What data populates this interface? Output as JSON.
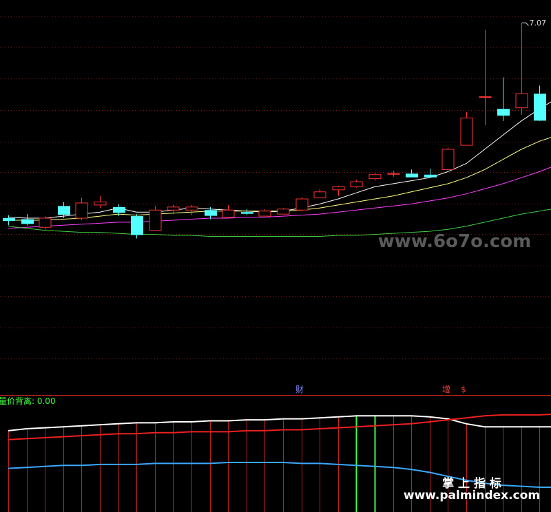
{
  "chart_data": [
    {
      "type": "candlestick",
      "panel": "price",
      "peak_label": "7.07",
      "colors": {
        "up": "#ff3232",
        "down": "#54ffff",
        "grid": "#8a1a1a",
        "bg": "#000000"
      },
      "ylim": [
        4.1,
        7.2
      ],
      "candles": [
        {
          "o": 5.14,
          "h": 5.17,
          "l": 5.07,
          "c": 5.12
        },
        {
          "o": 5.13,
          "h": 5.18,
          "l": 5.07,
          "c": 5.09
        },
        {
          "o": 5.05,
          "h": 5.16,
          "l": 5.02,
          "c": 5.14
        },
        {
          "o": 5.26,
          "h": 5.3,
          "l": 5.14,
          "c": 5.18
        },
        {
          "o": 5.14,
          "h": 5.34,
          "l": 5.12,
          "c": 5.29
        },
        {
          "o": 5.27,
          "h": 5.36,
          "l": 5.24,
          "c": 5.3
        },
        {
          "o": 5.25,
          "h": 5.28,
          "l": 5.16,
          "c": 5.2
        },
        {
          "o": 5.16,
          "h": 5.18,
          "l": 4.94,
          "c": 4.98
        },
        {
          "o": 5.02,
          "h": 5.26,
          "l": 5.02,
          "c": 5.22
        },
        {
          "o": 5.22,
          "h": 5.27,
          "l": 5.18,
          "c": 5.25
        },
        {
          "o": 5.22,
          "h": 5.27,
          "l": 5.17,
          "c": 5.25
        },
        {
          "o": 5.22,
          "h": 5.25,
          "l": 5.13,
          "c": 5.17
        },
        {
          "o": 5.15,
          "h": 5.27,
          "l": 5.15,
          "c": 5.22
        },
        {
          "o": 5.2,
          "h": 5.23,
          "l": 5.17,
          "c": 5.19
        },
        {
          "o": 5.16,
          "h": 5.23,
          "l": 5.16,
          "c": 5.21
        },
        {
          "o": 5.18,
          "h": 5.24,
          "l": 5.18,
          "c": 5.23
        },
        {
          "o": 5.22,
          "h": 5.35,
          "l": 5.21,
          "c": 5.33
        },
        {
          "o": 5.34,
          "h": 5.43,
          "l": 5.34,
          "c": 5.4
        },
        {
          "o": 5.42,
          "h": 5.46,
          "l": 5.36,
          "c": 5.45
        },
        {
          "o": 5.45,
          "h": 5.52,
          "l": 5.44,
          "c": 5.5
        },
        {
          "o": 5.53,
          "h": 5.59,
          "l": 5.51,
          "c": 5.57
        },
        {
          "o": 5.58,
          "h": 5.61,
          "l": 5.55,
          "c": 5.58
        },
        {
          "o": 5.58,
          "h": 5.62,
          "l": 5.56,
          "c": 5.55
        },
        {
          "o": 5.57,
          "h": 5.63,
          "l": 5.55,
          "c": 5.55
        },
        {
          "o": 5.62,
          "h": 5.84,
          "l": 5.62,
          "c": 5.82
        },
        {
          "o": 5.86,
          "h": 6.19,
          "l": 5.86,
          "c": 6.13
        },
        {
          "o": 6.34,
          "h": 7.0,
          "l": 6.06,
          "c": 6.34
        },
        {
          "o": 6.22,
          "h": 6.53,
          "l": 6.1,
          "c": 6.16
        },
        {
          "o": 6.23,
          "h": 7.07,
          "l": 6.16,
          "c": 6.37
        },
        {
          "o": 6.37,
          "h": 6.45,
          "l": 6.1,
          "c": 6.11
        },
        {
          "o": 6.12,
          "h": 6.9,
          "l": 6.12,
          "c": 6.9
        }
      ],
      "ma": [
        {
          "name": "MA5",
          "color": "#ffffff",
          "values": [
            5.15,
            5.14,
            5.14,
            5.16,
            5.18,
            5.2,
            5.24,
            5.2,
            5.2,
            5.22,
            5.24,
            5.23,
            5.22,
            5.21,
            5.2,
            5.21,
            5.24,
            5.28,
            5.33,
            5.39,
            5.45,
            5.48,
            5.51,
            5.54,
            5.6,
            5.68,
            5.82,
            5.96,
            6.1,
            6.22,
            6.33
          ]
        },
        {
          "name": "MA10",
          "color": "#ffff80",
          "values": [
            5.12,
            5.12,
            5.12,
            5.13,
            5.14,
            5.16,
            5.18,
            5.17,
            5.18,
            5.19,
            5.2,
            5.21,
            5.21,
            5.21,
            5.21,
            5.21,
            5.22,
            5.24,
            5.27,
            5.3,
            5.33,
            5.36,
            5.4,
            5.44,
            5.48,
            5.54,
            5.62,
            5.72,
            5.82,
            5.9,
            5.96
          ]
        },
        {
          "name": "MA20",
          "color": "#ff40ff",
          "values": [
            5.04,
            5.05,
            5.06,
            5.07,
            5.08,
            5.09,
            5.1,
            5.1,
            5.11,
            5.12,
            5.13,
            5.14,
            5.14,
            5.15,
            5.15,
            5.16,
            5.17,
            5.18,
            5.2,
            5.22,
            5.24,
            5.26,
            5.28,
            5.31,
            5.34,
            5.38,
            5.43,
            5.48,
            5.54,
            5.6,
            5.67
          ]
        },
        {
          "name": "MA60",
          "color": "#40d040",
          "values": [
            5.06,
            5.04,
            5.02,
            5.01,
            5.0,
            5.0,
            4.99,
            4.98,
            4.98,
            4.97,
            4.97,
            4.96,
            4.96,
            4.96,
            4.96,
            4.96,
            4.96,
            4.96,
            4.97,
            4.97,
            4.98,
            4.99,
            5.0,
            5.01,
            5.03,
            5.06,
            5.1,
            5.14,
            5.18,
            5.21,
            5.24
          ]
        }
      ]
    },
    {
      "type": "line",
      "panel": "indicator",
      "title": "量价背离: 0.00",
      "markers": [
        {
          "label": "财",
          "color": "#8888ff"
        },
        {
          "label": "增",
          "color": "#ff4040"
        },
        {
          "label": "$",
          "color": "#ff4040"
        }
      ],
      "ylim": [
        0,
        100
      ],
      "series": [
        {
          "name": "white",
          "color": "#ffffff",
          "values": [
            82,
            84,
            85,
            86,
            87,
            88,
            89,
            90,
            90,
            91,
            91,
            92,
            92,
            93,
            93,
            94,
            94,
            95,
            96,
            97,
            97,
            97,
            97,
            96,
            94,
            89,
            86,
            86,
            86,
            86,
            86
          ]
        },
        {
          "name": "red",
          "color": "#ee2020",
          "values": [
            73,
            74,
            75,
            76,
            77,
            78,
            79,
            79,
            80,
            80,
            81,
            81,
            81,
            82,
            82,
            83,
            83,
            84,
            85,
            86,
            87,
            88,
            89,
            91,
            93,
            95,
            97,
            98,
            98,
            98,
            99
          ]
        },
        {
          "name": "blue",
          "color": "#3ca8ff",
          "values": [
            44,
            45,
            46,
            47,
            47,
            48,
            48,
            48,
            49,
            49,
            49,
            49,
            50,
            50,
            50,
            50,
            49,
            49,
            48,
            47,
            46,
            45,
            43,
            40,
            36,
            32,
            29,
            27,
            26,
            25,
            25
          ]
        }
      ],
      "bars": [
        {
          "index": 19,
          "color": "#40ff40"
        },
        {
          "index": 20,
          "color": "#40ff40"
        }
      ]
    }
  ],
  "watermark": {
    "main": "www.6o7o.com",
    "brand": "掌 上 指 标",
    "url": "www.palmindex.com"
  }
}
